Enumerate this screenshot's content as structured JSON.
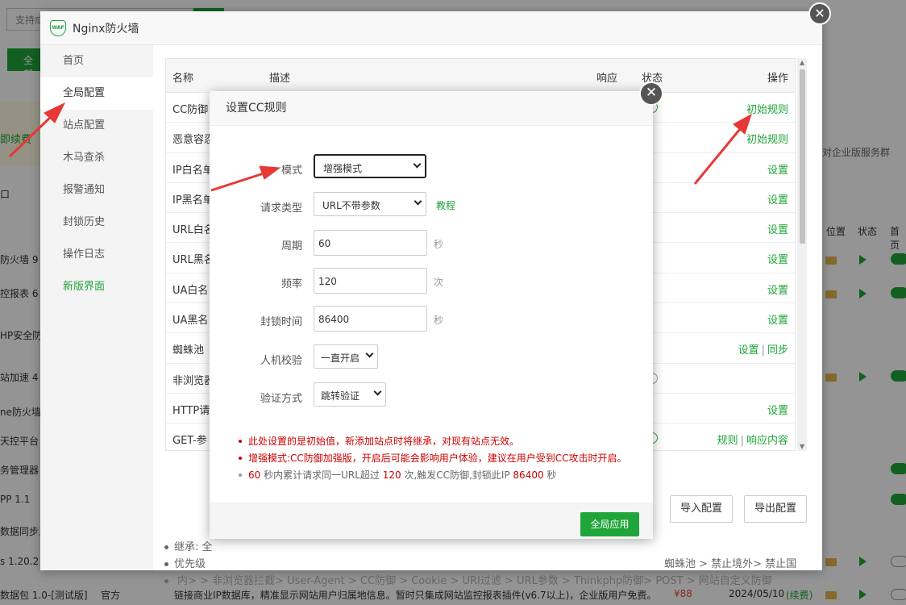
{
  "background": {
    "search_placeholder": "支持成",
    "all_button": "全部",
    "renew": "即续费",
    "left_labels": [
      "口",
      "防火墙 9",
      "控报表 6",
      "HP安全防",
      "站加速 4",
      "ne防火墙",
      "天控平台",
      "务管理器",
      "PP 1.1",
      "数据同步工",
      "s 1.20.2",
      "数据包 1.0-[测试版]"
    ],
    "right_note": "对企业版服务群",
    "right_heads": [
      "位置",
      "状态",
      "首页"
    ],
    "bottom_row": {
      "official": "官方",
      "description": "链接商业IP数据库，精准显示网站用户归属地信息。暂时只集成网站监控报表插件(v6.7以上)，企业版用户免费。",
      "price": "¥88",
      "date": "2024/05/10",
      "renew": "(续费)"
    }
  },
  "window": {
    "title": "Nginx防火墙",
    "logo": "WAF",
    "sidebar": [
      "首页",
      "全局配置",
      "站点配置",
      "木马查杀",
      "报警通知",
      "封锁历史",
      "操作日志",
      "新版界面"
    ],
    "table": {
      "headers": {
        "name": "名称",
        "desc": "描述",
        "resp": "响应",
        "status": "状态",
        "ops": "操作"
      },
      "rows": [
        {
          "name": "CC防御",
          "ops": [
            "初始规则"
          ]
        },
        {
          "name": "恶意容忍",
          "ops": [
            "初始规则"
          ]
        },
        {
          "name": "IP白名单",
          "ops": [
            "设置"
          ]
        },
        {
          "name": "IP黑名单",
          "ops": [
            "设置"
          ]
        },
        {
          "name": "URL白名",
          "ops": [
            "设置"
          ]
        },
        {
          "name": "URL黑名",
          "ops": [
            "设置"
          ]
        },
        {
          "name": "UA白名",
          "ops": [
            "设置"
          ]
        },
        {
          "name": "UA黑名",
          "ops": [
            "设置"
          ]
        },
        {
          "name": "蜘蛛池",
          "ops": [
            "设置",
            "同步"
          ]
        },
        {
          "name": "非浏览器",
          "ops": []
        },
        {
          "name": "HTTP请",
          "ops": [
            "设置"
          ]
        },
        {
          "name": "GET-参",
          "ops": [
            "规则",
            "响应内容"
          ]
        }
      ]
    },
    "import_button": "导入配置",
    "export_button": "导出配置",
    "notes": [
      "继承: 全",
      "优先级",
      "内> > 非浏览器拦截> User-Agent > CC防御 > Cookie > URI过滤 > URL参数 > Thinkphp防御> POST > 网站自定义防御"
    ],
    "notes_right": "蜘蛛池 > 禁止境外> 禁止国"
  },
  "dialog": {
    "title": "设置CC规则",
    "fields": {
      "mode": {
        "label": "模式",
        "value": "增强模式"
      },
      "request_type": {
        "label": "请求类型",
        "value": "URL不带参数",
        "tutorial": "教程"
      },
      "period": {
        "label": "周期",
        "value": "60",
        "unit": "秒"
      },
      "frequency": {
        "label": "频率",
        "value": "120",
        "unit": "次"
      },
      "block_time": {
        "label": "封锁时间",
        "value": "86400",
        "unit": "秒"
      },
      "captcha": {
        "label": "人机校验",
        "value": "一直开启"
      },
      "verify_method": {
        "label": "验证方式",
        "value": "跳转验证"
      }
    },
    "tips": {
      "t1": "此处设置的是初始值，新添加站点时将继承，对现有站点无效。",
      "t2": "增强模式:CC防御加强版，开启后可能会影响用户体验，建议在用户受到CC攻击时开启。",
      "t3_period": "60",
      "t3_a": " 秒内累计请求同一URL超过 ",
      "t3_freq": "120",
      "t3_b": " 次,触发CC防御,封锁此IP ",
      "t3_block": "86400",
      "t3_c": " 秒"
    },
    "apply_button": "全局应用"
  },
  "close_icon": "✕",
  "colors": {
    "brand": "#20a53a",
    "warning": "#cc0000",
    "annotation_arrow": "#e53935"
  }
}
